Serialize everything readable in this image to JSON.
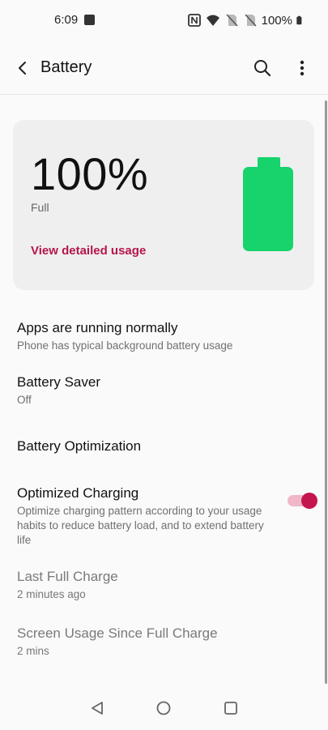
{
  "status_bar": {
    "time": "6:09",
    "battery_percent": "100%",
    "icons": [
      "gallery-icon",
      "nfc-icon",
      "wifi-icon",
      "no-sim-icon",
      "no-sim-icon",
      "battery-full-icon"
    ]
  },
  "app_bar": {
    "title": "Battery",
    "back_icon": "back-arrow-icon",
    "search_icon": "search-icon",
    "more_icon": "more-vert-icon"
  },
  "battery_card": {
    "percent": "100%",
    "state": "Full",
    "link": "View detailed usage",
    "level": 1.0,
    "battery_color": "#17d36c",
    "link_color": "#b5164a"
  },
  "settings": [
    {
      "title": "Apps are running normally",
      "subtitle": "Phone has typical background battery usage"
    },
    {
      "title": "Battery Saver",
      "subtitle": "Off"
    },
    {
      "title": "Battery Optimization"
    },
    {
      "title": "Optimized Charging",
      "subtitle": "Optimize charging pattern according to your usage habits to reduce battery load, and to extend battery life",
      "toggle_on": true
    },
    {
      "title": "Last Full Charge",
      "subtitle": "2 minutes ago"
    },
    {
      "title": "Screen Usage Since Full Charge",
      "subtitle": "2 mins"
    }
  ],
  "nav_bar": {
    "icons": [
      "nav-back-icon",
      "nav-home-icon",
      "nav-recents-icon"
    ]
  },
  "colors": {
    "accent": "#c4164e",
    "toggle_track": "#f0b7c8",
    "background": "#fafafa",
    "card": "#efefef"
  }
}
